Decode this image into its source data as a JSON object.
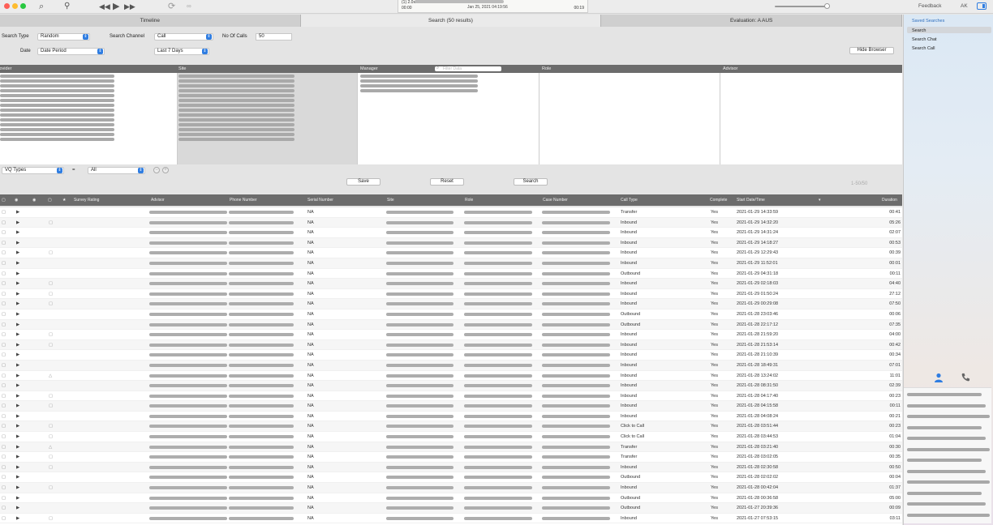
{
  "toolbar": {
    "feedback_label": "Feedback",
    "user_initials": "AK",
    "lcd": {
      "line1": "(1) 2.0x",
      "line2": "00:00",
      "date": "Jan 25, 2021  04:19:56",
      "end_time": "00:19"
    }
  },
  "tabs": [
    {
      "label": "Timeline"
    },
    {
      "label": "Search (50 results)"
    },
    {
      "label": "Evaluation: A AUS"
    }
  ],
  "form": {
    "search_type_label": "Search Type",
    "search_type_value": "Random",
    "search_channel_label": "Search Channel",
    "search_channel_value": "Call",
    "no_of_calls_label": "No Of Calls",
    "no_of_calls_value": "50",
    "date_label": "Date",
    "date_value": "Date Period",
    "period_value": "Last 7 Days",
    "hide_browser_label": "Hide Browser"
  },
  "browser": {
    "columns": [
      "Provider",
      "Site",
      "Manager",
      "Role",
      "Advisor"
    ],
    "filter_placeholder": "Filter Data"
  },
  "filters": {
    "vq_type_value": "VQ Types",
    "operator": "=",
    "vq_value": "All",
    "save_label": "Save",
    "reset_label": "Reset",
    "search_label": "Search",
    "results_count": "1-50/50"
  },
  "table": {
    "columns": [
      "Survey Rating",
      "Advisor",
      "Phone Number",
      "Serial Number",
      "Site",
      "Role",
      "Case Number",
      "Call Type",
      "Complete",
      "Start Date/Time",
      "Duration"
    ],
    "rows": [
      {
        "serial": "NA",
        "call_type": "Transfer",
        "complete": "Yes",
        "start": "2021-01-29 14:33:59",
        "duration": "00:41",
        "note": false,
        "alert": false
      },
      {
        "serial": "NA",
        "call_type": "Inbound",
        "complete": "Yes",
        "start": "2021-01-29 14:32:20",
        "duration": "05:26",
        "note": true,
        "alert": false
      },
      {
        "serial": "NA",
        "call_type": "Inbound",
        "complete": "Yes",
        "start": "2021-01-29 14:31:24",
        "duration": "02:07",
        "note": false,
        "alert": false
      },
      {
        "serial": "NA",
        "call_type": "Inbound",
        "complete": "Yes",
        "start": "2021-01-29 14:18:27",
        "duration": "00:53",
        "note": false,
        "alert": false
      },
      {
        "serial": "NA",
        "call_type": "Inbound",
        "complete": "Yes",
        "start": "2021-01-29 12:29:43",
        "duration": "00:39",
        "note": true,
        "alert": false
      },
      {
        "serial": "NA",
        "call_type": "Inbound",
        "complete": "Yes",
        "start": "2021-01-29 11:52:01",
        "duration": "00:01",
        "note": false,
        "alert": false
      },
      {
        "serial": "NA",
        "call_type": "Outbound",
        "complete": "Yes",
        "start": "2021-01-29 04:31:18",
        "duration": "00:11",
        "note": false,
        "alert": false
      },
      {
        "serial": "NA",
        "call_type": "Inbound",
        "complete": "Yes",
        "start": "2021-01-29 02:18:03",
        "duration": "04:40",
        "note": true,
        "alert": false
      },
      {
        "serial": "NA",
        "call_type": "Inbound",
        "complete": "Yes",
        "start": "2021-01-29 01:50:24",
        "duration": "27:12",
        "note": true,
        "alert": false
      },
      {
        "serial": "NA",
        "call_type": "Inbound",
        "complete": "Yes",
        "start": "2021-01-29 00:29:08",
        "duration": "07:50",
        "note": true,
        "alert": false
      },
      {
        "serial": "NA",
        "call_type": "Outbound",
        "complete": "Yes",
        "start": "2021-01-28 23:03:46",
        "duration": "00:06",
        "note": false,
        "alert": false
      },
      {
        "serial": "NA",
        "call_type": "Outbound",
        "complete": "Yes",
        "start": "2021-01-28 22:17:12",
        "duration": "07:35",
        "note": false,
        "alert": false
      },
      {
        "serial": "NA",
        "call_type": "Inbound",
        "complete": "Yes",
        "start": "2021-01-28 21:59:20",
        "duration": "04:00",
        "note": true,
        "alert": false
      },
      {
        "serial": "NA",
        "call_type": "Inbound",
        "complete": "Yes",
        "start": "2021-01-28 21:53:14",
        "duration": "00:42",
        "note": true,
        "alert": false
      },
      {
        "serial": "NA",
        "call_type": "Inbound",
        "complete": "Yes",
        "start": "2021-01-28 21:10:39",
        "duration": "00:34",
        "note": false,
        "alert": false
      },
      {
        "serial": "NA",
        "call_type": "Inbound",
        "complete": "Yes",
        "start": "2021-01-28 18:49:31",
        "duration": "07:01",
        "note": false,
        "alert": false
      },
      {
        "serial": "NA",
        "call_type": "Inbound",
        "complete": "Yes",
        "start": "2021-01-28 13:24:02",
        "duration": "11:01",
        "note": false,
        "alert": true
      },
      {
        "serial": "NA",
        "call_type": "Inbound",
        "complete": "Yes",
        "start": "2021-01-28 08:31:50",
        "duration": "02:39",
        "note": false,
        "alert": false
      },
      {
        "serial": "NA",
        "call_type": "Inbound",
        "complete": "Yes",
        "start": "2021-01-28 04:17:40",
        "duration": "00:23",
        "note": true,
        "alert": false
      },
      {
        "serial": "NA",
        "call_type": "Inbound",
        "complete": "Yes",
        "start": "2021-01-28 04:15:58",
        "duration": "00:11",
        "note": true,
        "alert": false
      },
      {
        "serial": "NA",
        "call_type": "Inbound",
        "complete": "Yes",
        "start": "2021-01-28 04:08:24",
        "duration": "00:21",
        "note": false,
        "alert": false
      },
      {
        "serial": "NA",
        "call_type": "Click to Call",
        "complete": "Yes",
        "start": "2021-01-28 03:51:44",
        "duration": "00:23",
        "note": true,
        "alert": false
      },
      {
        "serial": "NA",
        "call_type": "Click to Call",
        "complete": "Yes",
        "start": "2021-01-28 03:44:53",
        "duration": "01:04",
        "note": true,
        "alert": false
      },
      {
        "serial": "NA",
        "call_type": "Transfer",
        "complete": "Yes",
        "start": "2021-01-28 03:21:40",
        "duration": "00:30",
        "note": false,
        "alert": true
      },
      {
        "serial": "NA",
        "call_type": "Transfer",
        "complete": "Yes",
        "start": "2021-01-28 03:02:05",
        "duration": "00:35",
        "note": true,
        "alert": false
      },
      {
        "serial": "NA",
        "call_type": "Inbound",
        "complete": "Yes",
        "start": "2021-01-28 02:30:58",
        "duration": "00:50",
        "note": true,
        "alert": false
      },
      {
        "serial": "NA",
        "call_type": "Outbound",
        "complete": "Yes",
        "start": "2021-01-28 02:02:02",
        "duration": "00:04",
        "note": false,
        "alert": false
      },
      {
        "serial": "NA",
        "call_type": "Inbound",
        "complete": "Yes",
        "start": "2021-01-28 00:42:04",
        "duration": "01:37",
        "note": true,
        "alert": false
      },
      {
        "serial": "NA",
        "call_type": "Outbound",
        "complete": "Yes",
        "start": "2021-01-28 00:36:58",
        "duration": "05:00",
        "note": false,
        "alert": false
      },
      {
        "serial": "NA",
        "call_type": "Outbound",
        "complete": "Yes",
        "start": "2021-01-27 20:39:36",
        "duration": "00:09",
        "note": false,
        "alert": false
      },
      {
        "serial": "NA",
        "call_type": "Inbound",
        "complete": "Yes",
        "start": "2021-01-27 07:53:15",
        "duration": "03:11",
        "note": true,
        "alert": false
      }
    ]
  },
  "sidebar": {
    "header": "Saved Searches",
    "items": [
      "Search",
      "Search Chat",
      "Search Call"
    ]
  },
  "icons": {
    "search": "search-icon",
    "person": "person-icon",
    "phone": "phone-icon",
    "play": "play-icon",
    "note": "note-icon",
    "alert": "alert-icon"
  },
  "colors": {
    "accent": "#2f7de1",
    "header_gray": "#6c6c6c",
    "traffic_red": "#fe5f57",
    "traffic_yellow": "#febc2e",
    "traffic_green": "#28c840"
  }
}
